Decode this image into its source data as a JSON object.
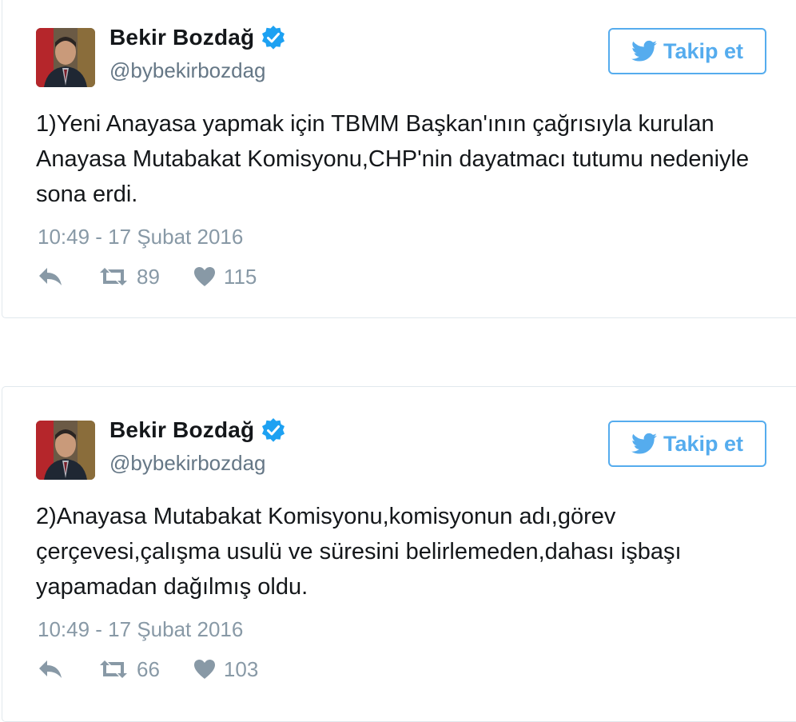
{
  "tweets": [
    {
      "user": {
        "name": "Bekir Bozdağ",
        "handle": "@bybekirbozdag",
        "verified": true
      },
      "follow_label": "Takip et",
      "text": "1)Yeni Anayasa yapmak için TBMM Başkan'ının çağrısıyla kurulan Anayasa Mutabakat Komisyonu,CHP'nin dayatmacı tutumu nedeniyle sona erdi.",
      "timestamp": "10:49 - 17 Şubat 2016",
      "retweets": "89",
      "likes": "115"
    },
    {
      "user": {
        "name": "Bekir Bozdağ",
        "handle": "@bybekirbozdag",
        "verified": true
      },
      "follow_label": "Takip et",
      "text": "2)Anayasa Mutabakat Komisyonu,komisyonun adı,görev çerçevesi,çalışma usulü ve süresini belirlemeden,dahası işbaşı yapamadan dağılmış oldu.",
      "timestamp": "10:49 - 17 Şubat 2016",
      "retweets": "66",
      "likes": "103"
    }
  ],
  "colors": {
    "accent": "#55acee",
    "verified": "#1da1f2",
    "muted": "#8899a6",
    "handle": "#657786",
    "border": "#e1e8ed"
  },
  "icons": {
    "reply": "reply-icon",
    "retweet": "retweet-icon",
    "like": "heart-icon",
    "follow": "twitter-bird-icon",
    "verified": "verified-badge-icon"
  }
}
